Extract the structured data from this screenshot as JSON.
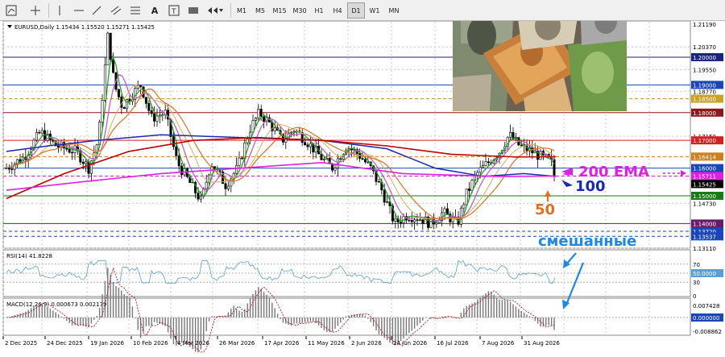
{
  "toolbar": {
    "timeframes": [
      "M1",
      "M5",
      "M15",
      "M30",
      "H1",
      "H4",
      "D1",
      "W1",
      "MN"
    ],
    "active_timeframe": "D1"
  },
  "main": {
    "header": "EURUSD,Daily  1.15434 1.15520 1.15271 1.15425",
    "price_labels": [
      "1.21190",
      "1.20370",
      "1.20000",
      "1.19550",
      "1.19000",
      "1.18770",
      "1.18500",
      "1.18000",
      "1.17150",
      "1.17000",
      "1.16414",
      "1.16000",
      "1.15711",
      "1.15425",
      "1.15000",
      "1.14730",
      "1.14000",
      "1.13720",
      "1.13537",
      "1.13110"
    ],
    "price_label_colors": {
      "1.20000": "#1a237e",
      "1.19000": "#1a46b8",
      "1.18500": "#c9a227",
      "1.18000": "#8b1a1a",
      "1.17000": "#d42020",
      "1.16414": "#d08020",
      "1.16000": "#1a46b8",
      "1.15711": "#e020e0",
      "1.15425": "#000000",
      "1.15000": "#1a7a1a",
      "1.14000": "#6a1a6a",
      "1.13720": "#1a46b8",
      "1.13537": "#1a46b8"
    },
    "annotations": {
      "ema200": "200 EMA",
      "ema100": "100",
      "ema50": "50"
    }
  },
  "rsi": {
    "label": "RSI(14) 41.8228",
    "levels": [
      "70",
      "50.0000",
      "30",
      "0"
    ],
    "note": "смешанные"
  },
  "macd": {
    "label": "MACD(12,26,9) 0.000673 0.002179",
    "levels": [
      "0.007428",
      "0.000000",
      "-0.008862"
    ]
  },
  "dates": [
    "2 Dec 2025",
    "24 Dec 2025",
    "19 Jan 2026",
    "10 Feb 2026",
    "4 Mar 2026",
    "26 Mar 2026",
    "17 Apr 2026",
    "11 May 2026",
    "2 Jun 2026",
    "24 Jun 2026",
    "16 Jul 2026",
    "7 Aug 2026",
    "31 Aug 2026"
  ],
  "colors": {
    "ema200": "#c00000",
    "ema100": "#1a2ab0",
    "ema50": "#e07020",
    "pink": "#e020e0",
    "green": "#22a022",
    "purple": "#c060c0",
    "tan": "#d8b060",
    "arrow_blue": "#1e88e5"
  }
}
